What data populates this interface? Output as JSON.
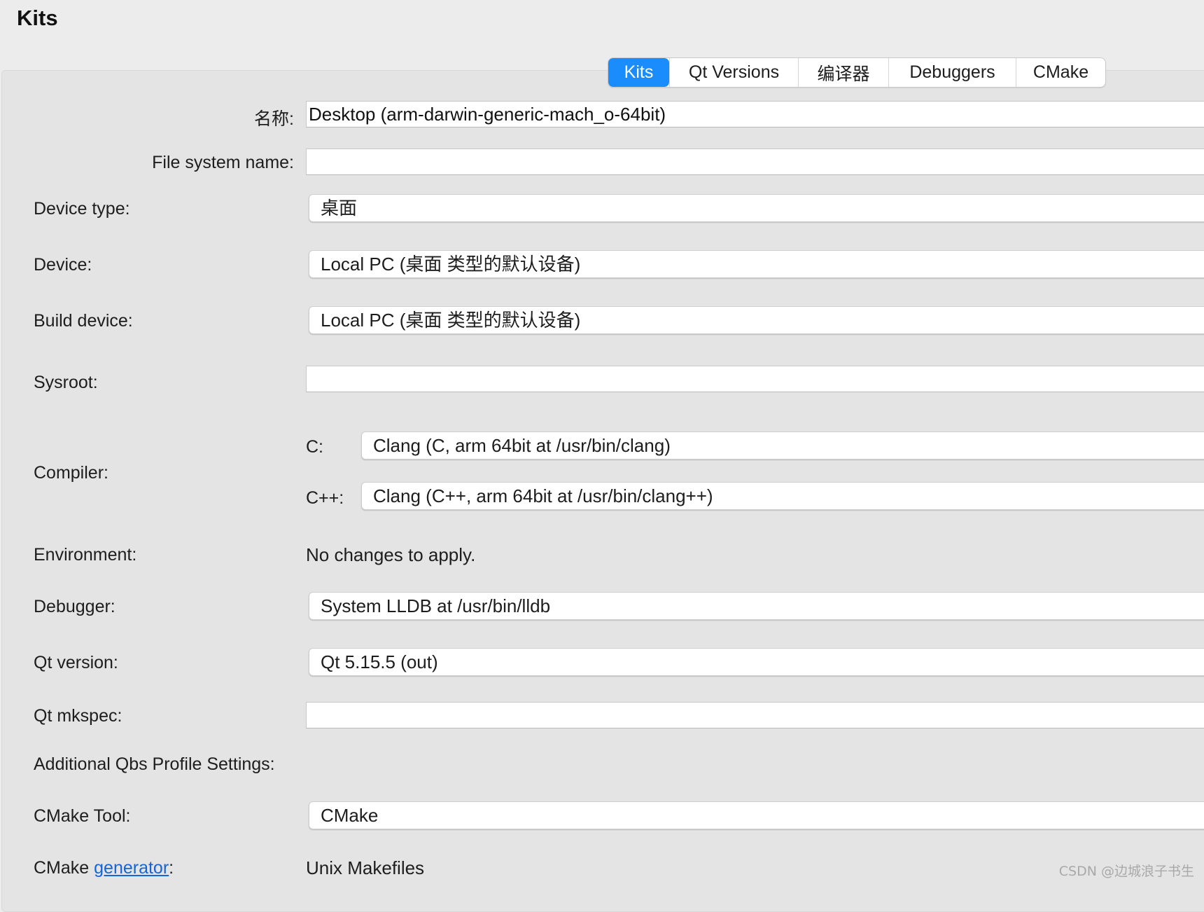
{
  "window": {
    "title": "Kits"
  },
  "tabs": [
    {
      "label": "Kits",
      "active": true
    },
    {
      "label": "Qt Versions",
      "active": false
    },
    {
      "label": "编译器",
      "active": false
    },
    {
      "label": "Debuggers",
      "active": false
    },
    {
      "label": "CMake",
      "active": false
    }
  ],
  "form": {
    "name": {
      "label": "名称:",
      "value": "Desktop (arm-darwin-generic-mach_o-64bit)"
    },
    "fs_name": {
      "label": "File system name:",
      "value": ""
    },
    "device_type": {
      "label": "Device type:",
      "value": "桌面"
    },
    "device": {
      "label": "Device:",
      "value": "Local PC (桌面 类型的默认设备)"
    },
    "build_device": {
      "label": "Build device:",
      "value": "Local PC (桌面 类型的默认设备)"
    },
    "sysroot": {
      "label": "Sysroot:",
      "value": ""
    },
    "compiler": {
      "label": "Compiler:",
      "c_label": "C:",
      "c_value": "Clang (C, arm 64bit at /usr/bin/clang)",
      "cpp_label": "C++:",
      "cpp_value": "Clang (C++, arm 64bit at /usr/bin/clang++)"
    },
    "environment": {
      "label": "Environment:",
      "value": "No changes to apply."
    },
    "debugger": {
      "label": "Debugger:",
      "value": "System LLDB at /usr/bin/lldb"
    },
    "qt_version": {
      "label": "Qt version:",
      "value": "Qt 5.15.5 (out)"
    },
    "qt_mkspec": {
      "label": "Qt mkspec:",
      "value": ""
    },
    "qbs": {
      "label": "Additional Qbs Profile Settings:"
    },
    "cmake_tool": {
      "label": "CMake Tool:",
      "value": "CMake"
    },
    "cmake_generator": {
      "label_prefix": "CMake",
      "label_link": "generator",
      "label_suffix": ":",
      "value": "Unix Makefiles"
    }
  },
  "watermark": "CSDN @边城浪子书生",
  "colors": {
    "accent": "#1a8cfb",
    "link": "#1565d8",
    "background": "#ececec"
  }
}
